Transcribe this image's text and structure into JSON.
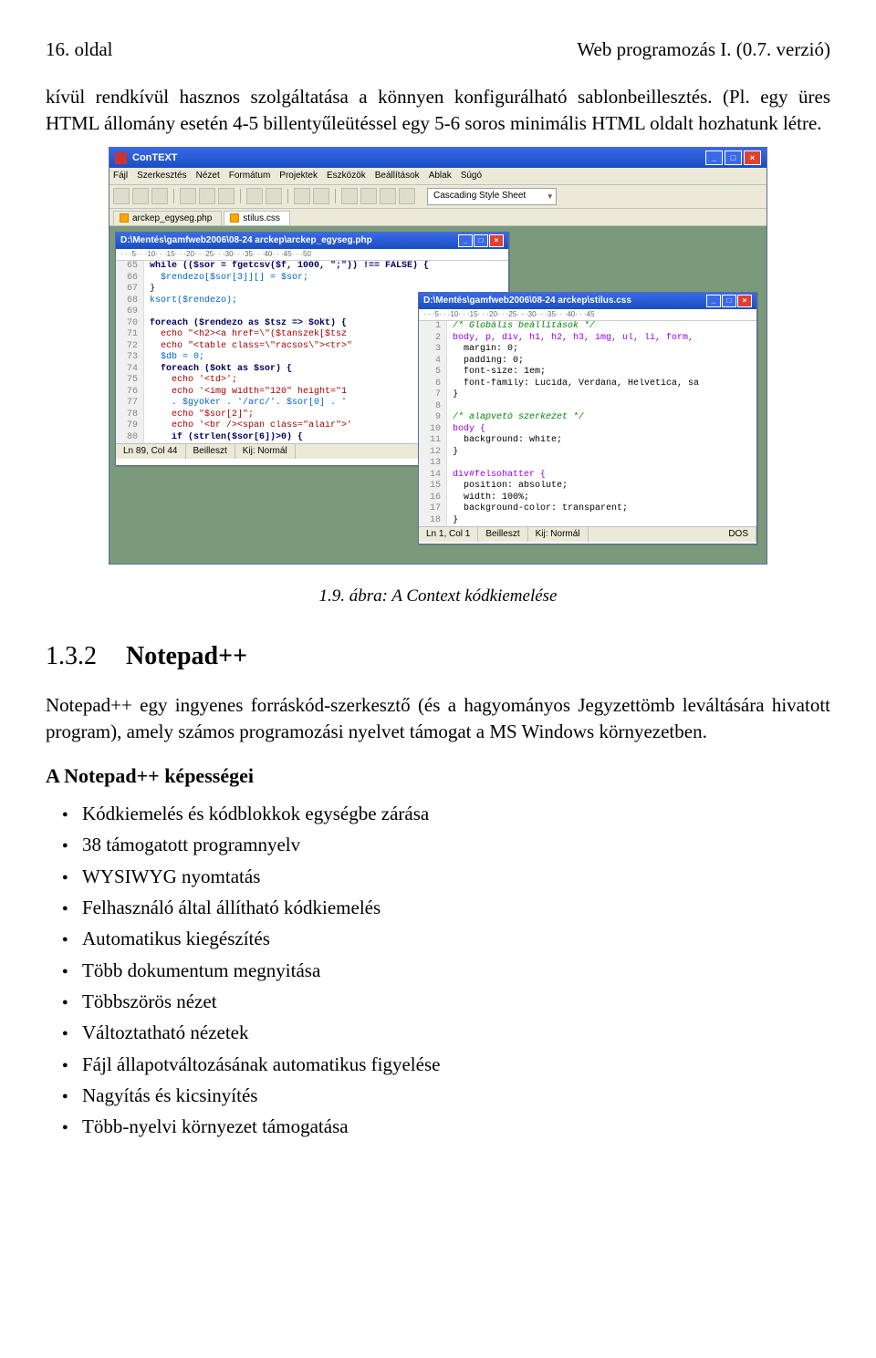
{
  "header": {
    "left": "16. oldal",
    "right": "Web programozás I. (0.7. verzió)"
  },
  "intro": "kívül rendkívül hasznos szolgáltatása a könnyen konfigurálható sablonbeillesztés. (Pl. egy üres HTML állomány esetén 4-5 billentyűleütéssel egy 5-6 soros minimális HTML oldalt hozhatunk létre.",
  "caption": "1.9. ábra: A Context kódkiemelése",
  "section": {
    "num": "1.3.2",
    "title": "Notepad++"
  },
  "section_body": "Notepad++ egy ingyenes forráskód-szerkesztő (és a hagyományos Jegyzettömb leváltására hivatott program), amely számos programozási nyelvet támogat a MS Windows környezetben.",
  "subheading": "A Notepad++ képességei",
  "features": [
    "Kódkiemelés és kódblokkok egységbe zárása",
    "38 támogatott programnyelv",
    "WYSIWYG nyomtatás",
    "Felhasználó által állítható kódkiemelés",
    "Automatikus kiegészítés",
    "Több dokumentum megnyitása",
    "Többszörös nézet",
    "Változtatható nézetek",
    "Fájl állapotváltozásának automatikus figyelése",
    "Nagyítás és kicsinyítés",
    "Több-nyelvi környezet támogatása"
  ],
  "app": {
    "title": "ConTEXT",
    "menus": [
      "Fájl",
      "Szerkesztés",
      "Nézet",
      "Formátum",
      "Projektek",
      "Eszközök",
      "Beállítások",
      "Ablak",
      "Súgó"
    ],
    "dropdown": "Cascading Style Sheet",
    "tabs": [
      "arckep_egyseg.php",
      "stilus.css"
    ],
    "doc1": {
      "title": "D:\\Mentés\\gamfweb2006\\08-24 arckep\\arckep_egyseg.php",
      "ruler": "· · ·5· · ·10· · ·15· · ·20· · ·25· · ·30· · ·35· · ·40· · ·45· · ·50",
      "lines": [
        {
          "n": 65,
          "c": "while (($sor = fgetcsv($f, 1000, \";\")) !== FALSE) {",
          "t": "kw"
        },
        {
          "n": 66,
          "c": "  $rendezo[$sor[3]][] = $sor;",
          "t": "var"
        },
        {
          "n": 67,
          "c": "}",
          "t": ""
        },
        {
          "n": 68,
          "c": "ksort($rendezo);",
          "t": "var"
        },
        {
          "n": 69,
          "c": "",
          "t": ""
        },
        {
          "n": 70,
          "c": "foreach ($rendezo as $tsz => $okt) {",
          "t": "kw"
        },
        {
          "n": 71,
          "c": "  echo \"<h2><a href=\\\"($tanszek[$tsz",
          "t": "str"
        },
        {
          "n": 72,
          "c": "  echo \"<table class=\\\"racsos\\\"><tr>\"",
          "t": "str"
        },
        {
          "n": 73,
          "c": "  $db = 0;",
          "t": "var"
        },
        {
          "n": 74,
          "c": "  foreach ($okt as $sor) {",
          "t": "kw"
        },
        {
          "n": 75,
          "c": "    echo '<td>';",
          "t": "str"
        },
        {
          "n": 76,
          "c": "    echo '<img width=\"120\" height=\"1",
          "t": "str"
        },
        {
          "n": 77,
          "c": "    . $gyoker . '/arc/'. $sor[0] . '",
          "t": "var"
        },
        {
          "n": 78,
          "c": "    echo \"$sor[2]\";",
          "t": "str"
        },
        {
          "n": 79,
          "c": "    echo '<br /><span class=\"alair\">'",
          "t": "str"
        },
        {
          "n": 80,
          "c": "    if (strlen($sor[6])>0) {",
          "t": "kw"
        }
      ],
      "status": {
        "pos": "Ln 89, Col 44",
        "b": "Beilleszt",
        "c": "Kij: Normál"
      }
    },
    "doc2": {
      "title": "D:\\Mentés\\gamfweb2006\\08-24 arckep\\stilus.css",
      "ruler": "· · ·5· · ·10· · ·15· · ·20· · ·25· · ·30· · ·35· · ·40· · ·45",
      "lines": [
        {
          "n": 1,
          "c": "/* Globális beállítások */",
          "t": "cm"
        },
        {
          "n": 2,
          "c": "body, p, div, h1, h2, h3, img, ul, li, form,",
          "t": "tag"
        },
        {
          "n": 3,
          "c": "  margin: 0;",
          "t": ""
        },
        {
          "n": 4,
          "c": "  padding: 0;",
          "t": ""
        },
        {
          "n": 5,
          "c": "  font-size: 1em;",
          "t": ""
        },
        {
          "n": 6,
          "c": "  font-family: Lucida, Verdana, Helvetica, sa",
          "t": ""
        },
        {
          "n": 7,
          "c": "}",
          "t": ""
        },
        {
          "n": 8,
          "c": "",
          "t": ""
        },
        {
          "n": 9,
          "c": "/* alapvető szerkezet */",
          "t": "cm"
        },
        {
          "n": 10,
          "c": "body {",
          "t": "tag"
        },
        {
          "n": 11,
          "c": "  background: white;",
          "t": ""
        },
        {
          "n": 12,
          "c": "}",
          "t": ""
        },
        {
          "n": 13,
          "c": "",
          "t": ""
        },
        {
          "n": 14,
          "c": "div#felsohatter {",
          "t": "tag"
        },
        {
          "n": 15,
          "c": "  position: absolute;",
          "t": ""
        },
        {
          "n": 16,
          "c": "  width: 100%;",
          "t": ""
        },
        {
          "n": 17,
          "c": "  background-color: transparent;",
          "t": ""
        },
        {
          "n": 18,
          "c": "}",
          "t": ""
        }
      ],
      "status": {
        "pos": "Ln 1, Col 1",
        "b": "Beilleszt",
        "c": "Kij: Normál",
        "d": "DOS"
      }
    }
  }
}
